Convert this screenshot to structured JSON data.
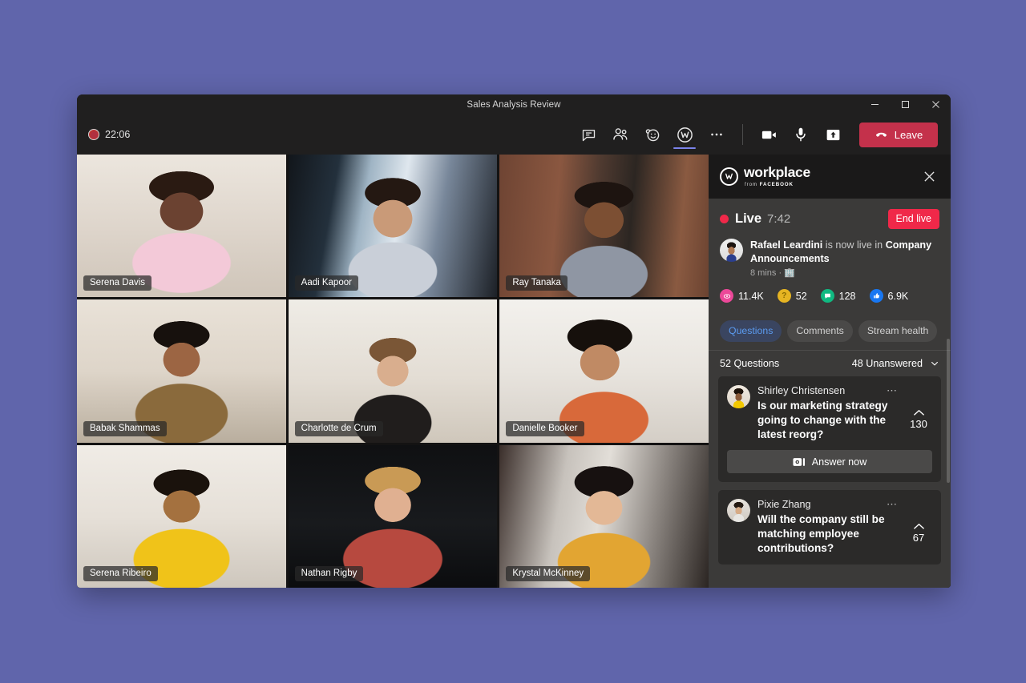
{
  "window": {
    "title": "Sales Analysis Review",
    "controls": {
      "minimize": "minimize-icon",
      "maximize": "maximize-icon",
      "close": "close-icon"
    }
  },
  "toolbar": {
    "recording_time": "22:06",
    "icons": [
      {
        "name": "chat-icon",
        "label": "Chat"
      },
      {
        "name": "people-icon",
        "label": "People"
      },
      {
        "name": "reactions-icon",
        "label": "Reactions"
      },
      {
        "name": "workplace-app-icon",
        "label": "Workplace",
        "active": true
      },
      {
        "name": "more-options-icon",
        "label": "More"
      }
    ],
    "controls": [
      {
        "name": "camera-icon",
        "label": "Camera"
      },
      {
        "name": "microphone-icon",
        "label": "Microphone"
      },
      {
        "name": "share-screen-icon",
        "label": "Share"
      }
    ],
    "leave_label": "Leave"
  },
  "participants": [
    {
      "name": "Serena Davis"
    },
    {
      "name": "Aadi Kapoor"
    },
    {
      "name": "Ray Tanaka"
    },
    {
      "name": "Babak Shammas"
    },
    {
      "name": "Charlotte de Crum"
    },
    {
      "name": "Danielle Booker"
    },
    {
      "name": "Serena Ribeiro"
    },
    {
      "name": "Nathan Rigby"
    },
    {
      "name": "Krystal McKinney"
    }
  ],
  "workplace_panel": {
    "brand": {
      "mark": "workplace-w-icon",
      "wordmark": "workplace",
      "from_prefix": "from ",
      "from_brand": "FACEBOOK"
    },
    "close_icon": "close-icon",
    "live": {
      "label": "Live",
      "elapsed": "7:42",
      "end_button": "End live"
    },
    "post": {
      "author": "Rafael Leardini",
      "action": " is now live in ",
      "destination": "Company Announcements",
      "meta": "8 mins ·",
      "meta_icon": "group-icon"
    },
    "stats": [
      {
        "icon": "views-eye-icon",
        "value": "11.4K",
        "color": "#ec4899"
      },
      {
        "icon": "question-badge-icon",
        "value": "52",
        "color": "#e6b422"
      },
      {
        "icon": "comment-icon",
        "value": "128",
        "color": "#10b981"
      },
      {
        "icon": "thumbs-up-icon",
        "value": "6.9K",
        "color": "#1877f2"
      }
    ],
    "tabs": [
      {
        "label": "Questions",
        "active": true
      },
      {
        "label": "Comments",
        "active": false
      },
      {
        "label": "Stream health",
        "active": false
      }
    ],
    "summary": {
      "count_label": "52 Questions",
      "filter_label": "48 Unanswered",
      "filter_icon": "chevron-down-icon"
    },
    "questions": [
      {
        "author": "Shirley Christensen",
        "text": "Is our marketing strategy going to change with the latest reorg?",
        "votes": "130",
        "vote_icon": "chevron-up-icon",
        "menu_icon": "more-options-icon",
        "answer_label": "Answer now",
        "answer_icon": "go-live-icon",
        "has_answer_button": true
      },
      {
        "author": "Pixie Zhang",
        "text": "Will the company still be matching employee contributions?",
        "votes": "67",
        "vote_icon": "chevron-up-icon",
        "menu_icon": "more-options-icon",
        "has_answer_button": false
      }
    ]
  },
  "colors": {
    "desktop_background": "#6065ab",
    "window_chrome": "#201f1f",
    "panel_background": "#3b3a39",
    "leave_red": "#c4314b",
    "live_red": "#f02849",
    "accent_blue": "#7b83eb",
    "active_tab_blue": "#5b9bf0"
  }
}
